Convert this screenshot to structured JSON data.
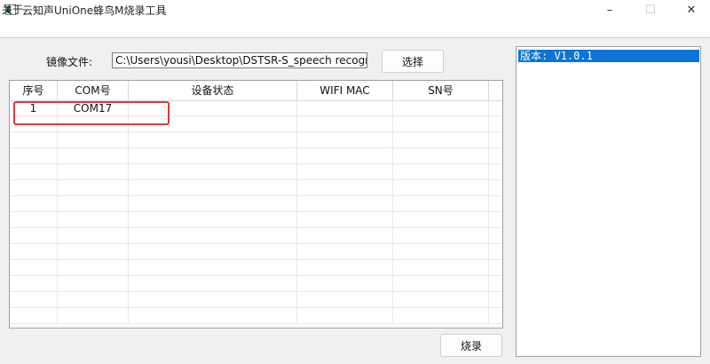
{
  "window": {
    "title": "云知声UniOne蜂鸟M烧录工具",
    "controls": {
      "minimize": "–",
      "maximize": "☐",
      "close": "✕"
    }
  },
  "menu": {
    "items": [
      {
        "label": "关于"
      }
    ]
  },
  "file": {
    "label": "镜像文件:",
    "path": "C:\\Users\\yousi\\Desktop\\DSTSR-S_speech recognition_",
    "select_label": "选择"
  },
  "table": {
    "columns": [
      "序号",
      "COM号",
      "设备状态",
      "WIFI MAC",
      "SN号"
    ],
    "rows": [
      [
        "1",
        "COM17",
        "",
        "",
        ""
      ]
    ]
  },
  "burn_label": "烧录",
  "right_panel": {
    "items": [
      "版本: V1.0.1"
    ]
  },
  "colors": {
    "selection": "#0b74d6",
    "highlight_box": "#e03a36"
  }
}
